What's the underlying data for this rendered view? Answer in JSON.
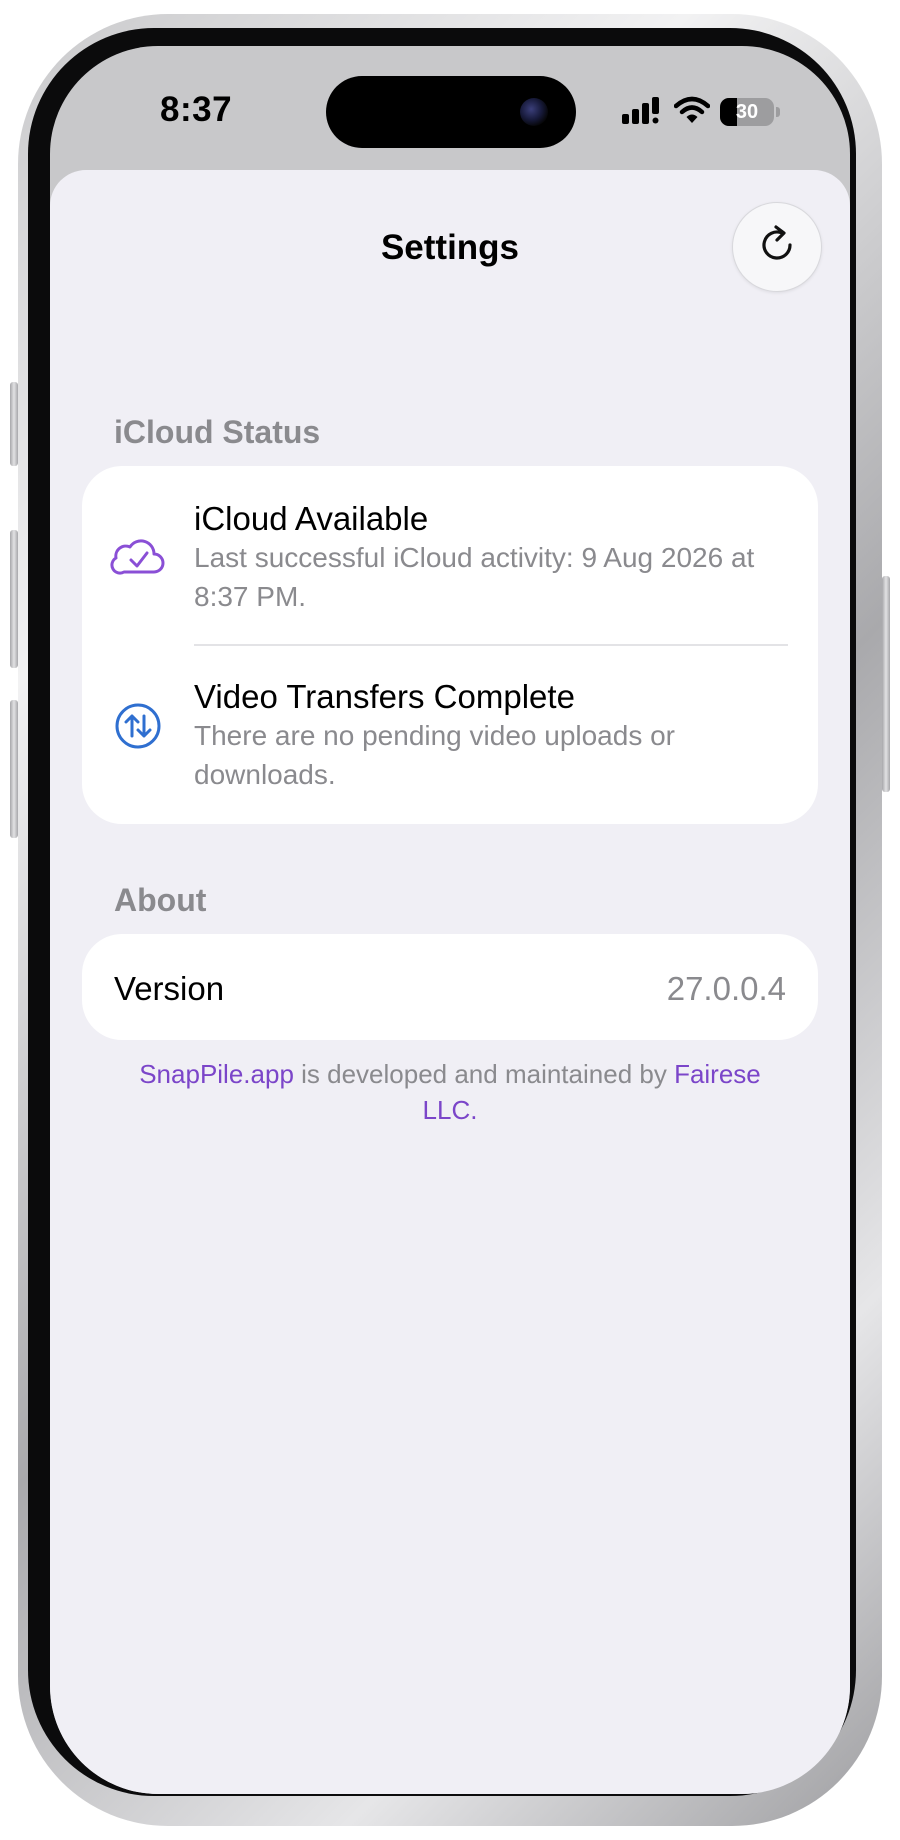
{
  "status_bar": {
    "time": "8:37",
    "battery": "30",
    "icons": [
      "cellular-signal-icon",
      "wifi-icon",
      "battery-icon"
    ]
  },
  "sheet": {
    "title": "Settings",
    "refresh_icon": "refresh-icon"
  },
  "icloud_section": {
    "header": "iCloud Status",
    "rows": [
      {
        "icon": "cloud-check-icon",
        "icon_color": "#8a4fd6",
        "title": "iCloud Available",
        "subtitle": "Last successful iCloud activity: 9 Aug 2026 at 8:37 PM."
      },
      {
        "icon": "transfer-arrows-icon",
        "icon_color": "#2f6fd0",
        "title": "Video Transfers Complete",
        "subtitle": "There are no pending video uploads or downloads."
      }
    ]
  },
  "about_section": {
    "header": "About",
    "version_label": "Version",
    "version_value": "27.0.0.4"
  },
  "footer": {
    "link1": "SnapPile.app",
    "middle": " is developed and maintained by ",
    "link2": "Fairese LLC",
    "end": ".",
    "link_color": "#7b45c9"
  }
}
